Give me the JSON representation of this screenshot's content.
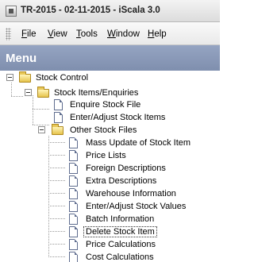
{
  "window": {
    "title": "TR-2015 - 02-11-2015 - iScala 3.0"
  },
  "menubar": {
    "items": [
      {
        "label": "File",
        "key": "F",
        "rest": "ile"
      },
      {
        "label": "View",
        "key": "V",
        "rest": "iew"
      },
      {
        "label": "Tools",
        "key": "T",
        "rest": "ools"
      },
      {
        "label": "Window",
        "key": "W",
        "rest": "indow"
      },
      {
        "label": "Help",
        "key": "H",
        "rest": "elp"
      }
    ]
  },
  "menu_panel": {
    "title": "Menu"
  },
  "tree": {
    "stock_control": "Stock Control",
    "stock_items_enquiries": "Stock Items/Enquiries",
    "enquire_stock_file": "Enquire Stock File",
    "enter_adjust_stock_items": "Enter/Adjust Stock Items",
    "other_stock_files": "Other Stock Files",
    "children": [
      "Mass Update of Stock Item",
      "Price Lists",
      "Foreign Descriptions",
      "Extra Descriptions",
      "Warehouse Information",
      "Enter/Adjust Stock Values",
      "Batch Information",
      "Delete Stock Item",
      "Price Calculations",
      "Cost Calculations"
    ],
    "selected": "Delete Stock Item"
  },
  "colors": {
    "menu_header": "#8795b4",
    "folder": "#e6c44c"
  }
}
